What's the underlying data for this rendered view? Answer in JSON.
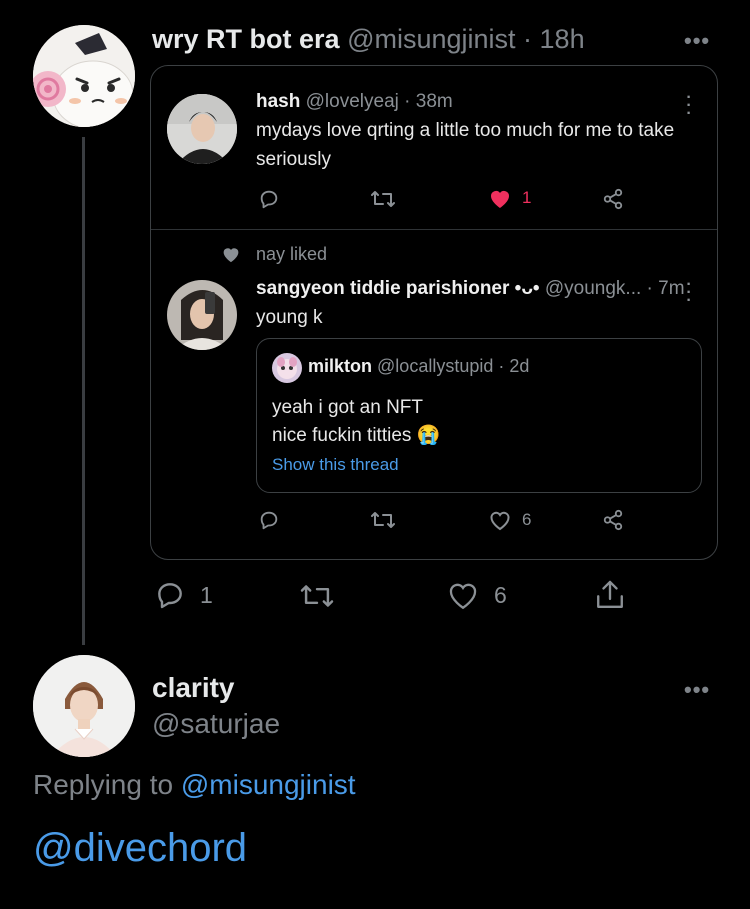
{
  "top_tweet": {
    "author_name": "wry RT bot era",
    "handle": "@misungjinist",
    "time": "· 18h",
    "more_icon": "ellipsis-icon",
    "replies": "1",
    "likes": "6"
  },
  "quote_one": {
    "name": "hash",
    "handle": "@lovelyeaj",
    "time": "· 38m",
    "text": "mydays love qrting a little too much for me to take seriously",
    "likes": "1",
    "like_color": "#f0305e"
  },
  "quote_two": {
    "social_context": "nay liked",
    "name": "sangyeon tiddie parishioner •ᴗ•",
    "handle": "@youngk...",
    "time": "· 7m",
    "text": "young k",
    "likes": "6",
    "nested": {
      "name": "milkton",
      "handle": "@locallystupid",
      "time": "· 2d",
      "line1": "yeah i got an NFT",
      "line2": "nice fuckin titties 😭",
      "show_thread": "Show this thread"
    }
  },
  "reply": {
    "name": "clarity",
    "handle": "@saturjae",
    "replying_prefix": "Replying to",
    "replying_to": "@misungjinist",
    "text": "@divechord"
  },
  "colors": {
    "link": "#4a9be8",
    "like": "#f0305e",
    "muted": "#7e8389"
  }
}
